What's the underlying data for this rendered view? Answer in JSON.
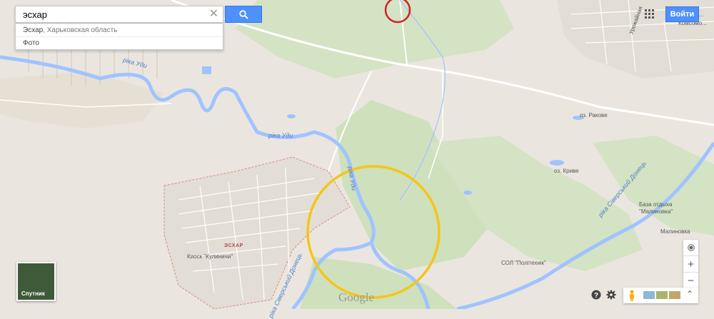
{
  "search": {
    "value": "эсхар",
    "clear_icon": "close-icon",
    "button_icon": "search-icon"
  },
  "suggestions": [
    {
      "bold": "Эсхар",
      "rest": ", Харьковская область"
    },
    {
      "bold": "Фото",
      "rest": ""
    }
  ],
  "header": {
    "apps_icon": "apps-grid-icon",
    "signin_label": "Войти"
  },
  "map_labels": {
    "river_udy_top": "ріка Уди",
    "river_udy_mid": "ріка Уди",
    "river_udy_vertical": "ріка Уди",
    "lake_rakove": "оз. Ракове",
    "lake_kryve": "оз. Криве",
    "river_donets": "ріка Сіверський Донець",
    "river_donets_left": "ріка Сіверський Донець",
    "base": "База отдыха\n\"Малиновка\"",
    "malinovka": "Малиновка",
    "sol": "СОЛ \"Політехнік\"",
    "town": "ЭСХАР",
    "kiosk": "Киоск \"Кулиничи\"",
    "street_top1": "Ломоно...",
    "street_top2": "Комсомо...",
    "street_top3": "Урожайная"
  },
  "satellite": {
    "label": "Спутник"
  },
  "zoom": {
    "plus": "+",
    "minus": "−"
  },
  "brand": "Google",
  "colors": {
    "river": "#a0c3ff",
    "highlight_circle": "#f5c518",
    "top_circle": "#d0202a",
    "button": "#4d90fe"
  }
}
